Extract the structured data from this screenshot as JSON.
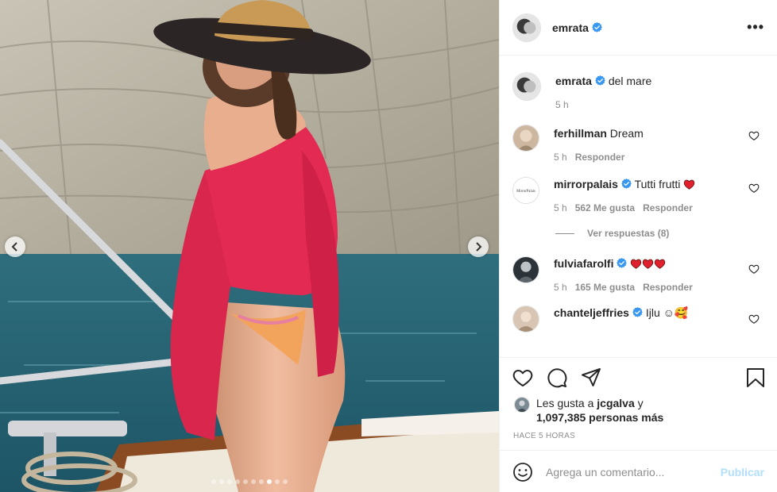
{
  "post": {
    "author": "emrata",
    "caption": "del mare",
    "caption_time": "5 h",
    "more_label": "•••"
  },
  "media": {
    "slide_count": 10,
    "active_slide": 8
  },
  "comments": [
    {
      "user": "ferhillman",
      "text": "Dream",
      "time": "5 h",
      "likes": "",
      "reply": "Responder",
      "verified": false
    },
    {
      "user": "mirrorpalais",
      "text": "Tutti frutti",
      "time": "5 h",
      "likes": "562 Me gusta",
      "reply": "Responder",
      "verified": true,
      "emoji": [
        "red-heart"
      ]
    },
    {
      "user": "fulviafarolfi",
      "text": "",
      "time": "5 h",
      "likes": "165 Me gusta",
      "reply": "Responder",
      "verified": true,
      "emoji": [
        "red-heart",
        "red-heart",
        "red-heart"
      ]
    },
    {
      "user": "chanteljeffries",
      "text": "Ijlu ☺🥰",
      "verified": true
    }
  ],
  "view_replies": "Ver respuestas (8)",
  "mirror_avatar_text": "MirrorPalais",
  "likes": {
    "prefix": "Les gusta a",
    "user": "jcgalva",
    "joiner": "y",
    "count_text": "1,097,385 personas más"
  },
  "timestamp": "HACE 5 HORAS",
  "add_comment": {
    "placeholder": "Agrega un comentario...",
    "publish": "Publicar"
  },
  "colors": {
    "verified": "#3897f0",
    "heart_red": "#ed4956",
    "publish_disabled": "#b2dffc",
    "muted": "#8e8e8e"
  },
  "icons": [
    "verified-badge-icon",
    "heart-icon",
    "comment-icon",
    "share-icon",
    "bookmark-icon",
    "smile-icon",
    "chevron-left-icon",
    "chevron-right-icon",
    "more-icon"
  ]
}
